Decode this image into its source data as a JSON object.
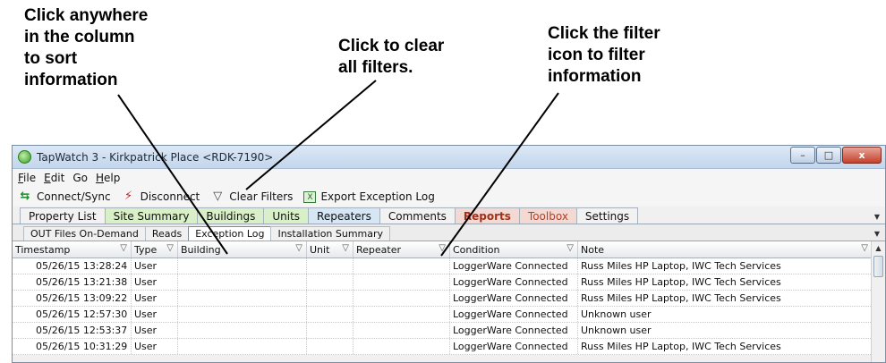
{
  "annotations": {
    "sort": "Click anywhere\nin the column\nto sort\ninformation",
    "clear": "Click to clear\nall filters.",
    "filter": "Click the filter\nicon to filter\ninformation"
  },
  "window": {
    "title": "TapWatch 3 - Kirkpatrick Place <RDK-7190>",
    "controls": {
      "minimize": "–",
      "maximize": "□",
      "close": "x"
    }
  },
  "menu": {
    "file": {
      "accel": "F",
      "rest": "ile"
    },
    "edit": {
      "accel": "E",
      "rest": "dit"
    },
    "go": "Go",
    "help": {
      "accel": "H",
      "rest": "elp"
    }
  },
  "toolbar": {
    "connect": "Connect/Sync",
    "disconnect": "Disconnect",
    "clear_filters": "Clear Filters",
    "export": "Export Exception Log",
    "export_icon_glyph": "X"
  },
  "tabs": [
    "Property List",
    "Site Summary",
    "Buildings",
    "Units",
    "Repeaters",
    "Comments",
    "Reports",
    "Toolbox",
    "Settings"
  ],
  "subtabs": [
    "OUT Files On-Demand",
    "Reads",
    "Exception Log",
    "Installation Summary"
  ],
  "active_subtab": "Exception Log",
  "columns": [
    "Timestamp",
    "Type",
    "Building",
    "Unit",
    "Repeater",
    "Condition",
    "Note"
  ],
  "rows": [
    [
      "05/26/15 13:28:24",
      "User",
      "",
      "",
      "",
      "LoggerWare Connected",
      "Russ Miles HP Laptop, IWC Tech Services"
    ],
    [
      "05/26/15 13:21:38",
      "User",
      "",
      "",
      "",
      "LoggerWare Connected",
      "Russ Miles HP Laptop, IWC Tech Services"
    ],
    [
      "05/26/15 13:09:22",
      "User",
      "",
      "",
      "",
      "LoggerWare Connected",
      "Russ Miles HP Laptop, IWC Tech Services"
    ],
    [
      "05/26/15 12:57:30",
      "User",
      "",
      "",
      "",
      "LoggerWare Connected",
      "Unknown user"
    ],
    [
      "05/26/15 12:53:37",
      "User",
      "",
      "",
      "",
      "LoggerWare Connected",
      "Unknown user"
    ],
    [
      "05/26/15 10:31:29",
      "User",
      "",
      "",
      "",
      "LoggerWare Connected",
      "Russ Miles HP Laptop, IWC Tech Services"
    ]
  ],
  "icons": {
    "sync": "sync-arrows-icon",
    "disconnect": "disconnect-icon",
    "filter": "filter-funnel-icon",
    "export": "excel-export-icon"
  }
}
